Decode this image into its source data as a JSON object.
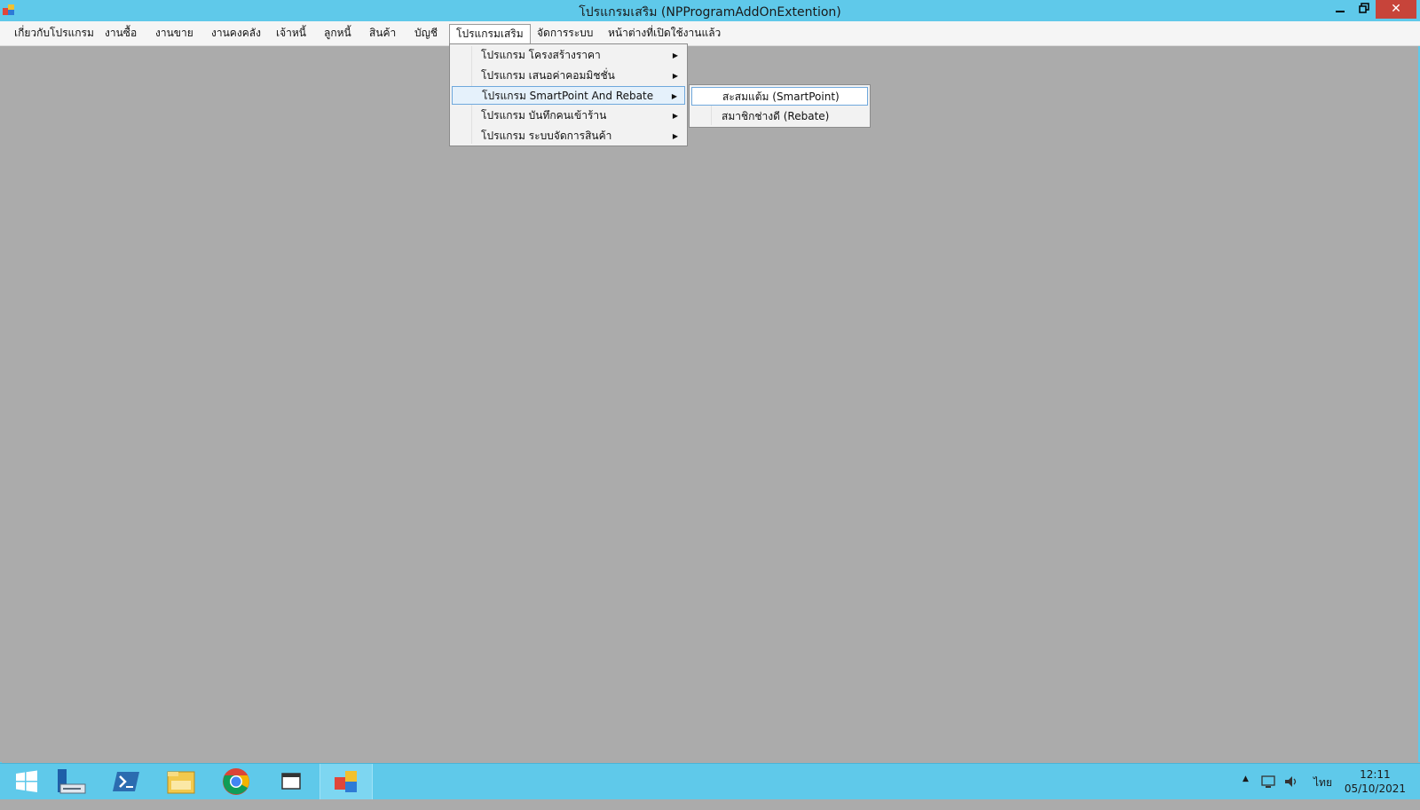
{
  "window": {
    "title": "โปรแกรมเสริม (NPProgramAddOnExtention)",
    "minimize": "—",
    "close": "✕"
  },
  "menubar": [
    "เกี่ยวกับโปรแกรม",
    "งานซื้อ",
    "งานขาย",
    "งานคงคลัง",
    "เจ้าหนี้",
    "ลูกหนี้",
    "สินค้า",
    "บัญชี",
    "โปรแกรมเสริม",
    "จัดการระบบ",
    "หน้าต่างที่เปิดใช้งานแล้ว"
  ],
  "dropdown": {
    "items": [
      "โปรแกรม โครงสร้างราคา",
      "โปรแกรม เสนอค่าคอมมิชชั่น",
      "โปรแกรม SmartPoint And Rebate",
      "โปรแกรม บันทึกคนเข้าร้าน",
      "โปรแกรม ระบบจัดการสินค้า"
    ],
    "arrow": "▶"
  },
  "submenu": {
    "items": [
      "สะสมแต้ม (SmartPoint)",
      "สมาชิกช่างดี (Rebate)"
    ]
  },
  "taskbar": {
    "icons": [
      "windows-start-icon",
      "server-manager-icon",
      "powershell-icon",
      "file-explorer-icon",
      "chrome-icon",
      "app-window-icon",
      "npprogram-icon"
    ],
    "tray_arrow": "▲",
    "language": "ไทย",
    "time": "12:11",
    "date": "05/10/2021"
  },
  "colors": {
    "titlebar": "#5fc9ea",
    "client": "#ababab",
    "highlight_border": "#6fa8dc",
    "close_button": "#c7443a"
  }
}
